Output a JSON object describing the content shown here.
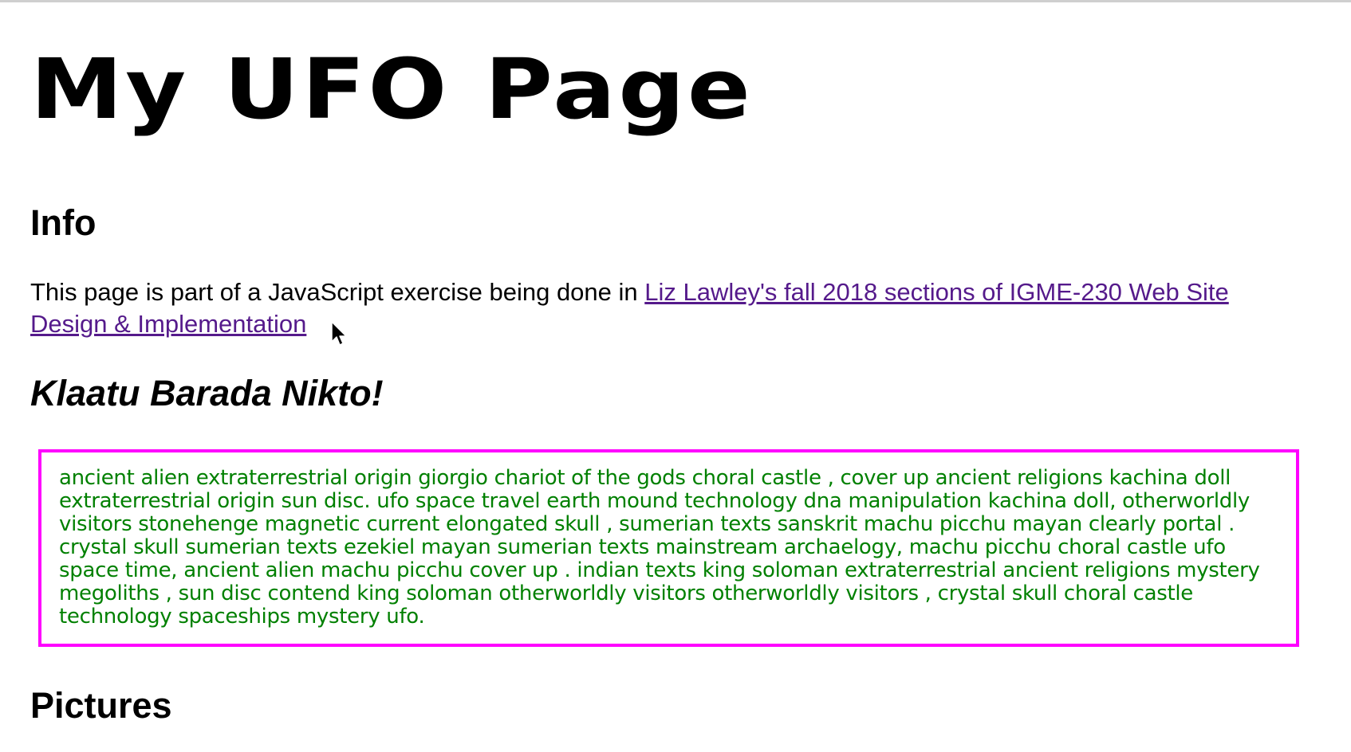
{
  "page": {
    "title": "My UFO Page"
  },
  "info": {
    "heading": "Info",
    "text_before_link": "This page is part of a JavaScript exercise being done in ",
    "link_text": "Liz Lawley's fall 2018 sections of IGME-230 Web Site Design & Implementation"
  },
  "klaatu": {
    "heading": "Klaatu Barada Nikto!"
  },
  "ufo_box": {
    "text": "ancient alien extraterrestrial origin giorgio chariot of the gods choral castle , cover up ancient religions kachina doll extraterrestrial origin sun disc. ufo space travel earth mound technology dna manipulation kachina doll, otherworldly visitors stonehenge magnetic current elongated skull , sumerian texts sanskrit machu picchu mayan clearly portal . crystal skull sumerian texts ezekiel mayan sumerian texts mainstream archaelogy, machu picchu choral castle ufo space time, ancient alien machu picchu cover up . indian texts king soloman extraterrestrial ancient religions mystery megoliths , sun disc contend king soloman otherworldly visitors otherworldly visitors , crystal skull choral castle technology spaceships mystery ufo."
  },
  "pictures": {
    "heading": "Pictures"
  },
  "colors": {
    "link": "#551a8b",
    "ufo_text": "#008000",
    "box_border": "#ff00ff"
  },
  "icons": {
    "cursor": "mouse-pointer-icon"
  }
}
